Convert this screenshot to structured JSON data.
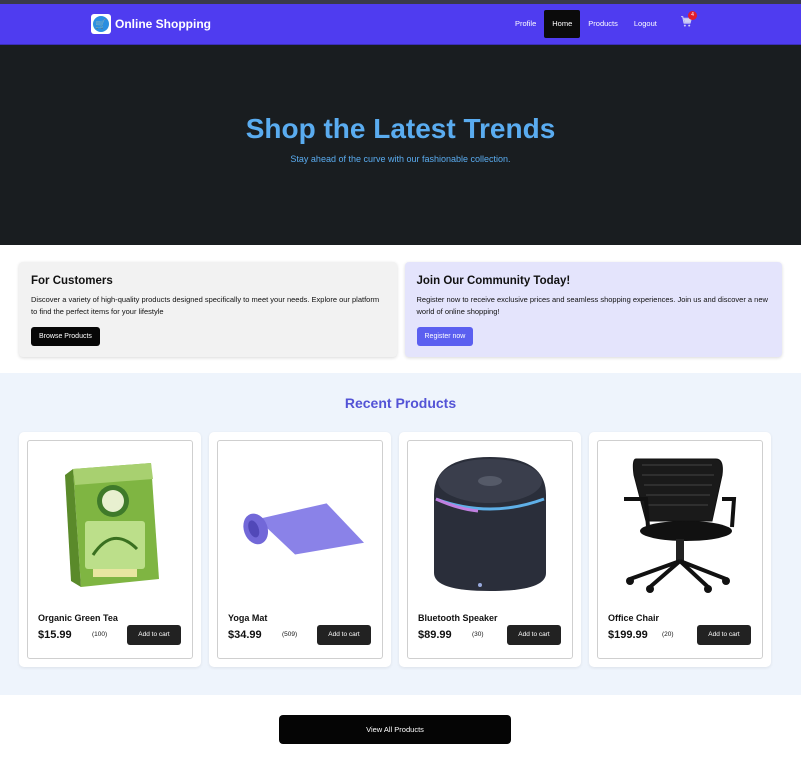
{
  "navbar": {
    "brand": "Online Shopping",
    "links": [
      "Profile",
      "Home",
      "Products",
      "Logout"
    ],
    "active": "Home",
    "cart_count": "4"
  },
  "hero": {
    "title": "Shop the Latest Trends",
    "subtitle": "Stay ahead of the curve with our fashionable collection."
  },
  "promo": {
    "customers": {
      "title": "For Customers",
      "text": "Discover a variety of high-quality products designed specifically to meet your needs. Explore our platform to find the perfect items for your lifestyle",
      "button": "Browse Products"
    },
    "community": {
      "title": "Join Our Community Today!",
      "text": "Register now to receive exclusive prices and seamless shopping experiences. Join us and discover a new world of online shopping!",
      "button": "Register now"
    }
  },
  "recent": {
    "title": "Recent Products",
    "products": [
      {
        "name": "Organic Green Tea",
        "price": "$15.99",
        "reviews": "(100)",
        "button": "Add to cart",
        "icon": "green-tea-box-icon"
      },
      {
        "name": "Yoga Mat",
        "price": "$34.99",
        "reviews": "(509)",
        "button": "Add to cart",
        "icon": "yoga-mat-icon"
      },
      {
        "name": "Bluetooth Speaker",
        "price": "$89.99",
        "reviews": "(30)",
        "button": "Add to cart",
        "icon": "speaker-icon"
      },
      {
        "name": "Office Chair",
        "price": "$199.99",
        "reviews": "(20)",
        "button": "Add to cart",
        "icon": "office-chair-icon"
      }
    ]
  },
  "view_all": "View All Products",
  "colors": {
    "navbar": "#4f3cf0",
    "hero_bg": "#191d20",
    "hero_text": "#5aacf0",
    "accent": "#5353d6",
    "register_button": "#5b5ff0"
  }
}
